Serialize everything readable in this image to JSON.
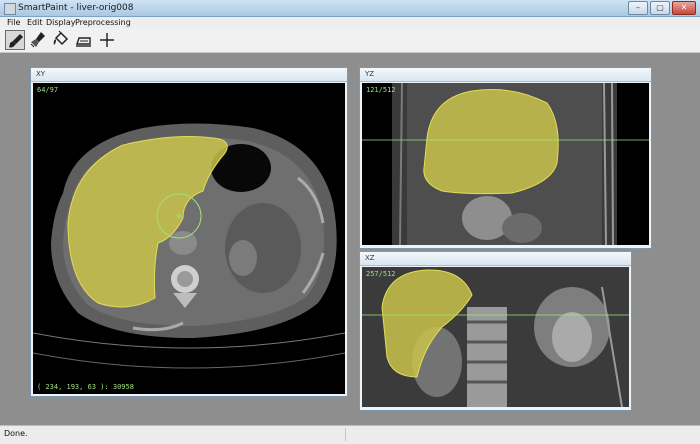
{
  "window": {
    "title": "SmartPaint - liver-orig008",
    "buttons": [
      "–",
      "▢",
      "✕"
    ]
  },
  "menu": {
    "items": [
      "File",
      "Edit",
      "Display",
      "Preprocessing"
    ]
  },
  "toolbar": {
    "tools": [
      {
        "name": "paint-brush-icon",
        "active": true
      },
      {
        "name": "sweep-brush-icon",
        "active": false
      },
      {
        "name": "bucket-fill-icon",
        "active": false
      },
      {
        "name": "iron-icon",
        "active": false
      },
      {
        "name": "crosshair-icon",
        "active": false
      }
    ]
  },
  "views": {
    "xy": {
      "title": "XY",
      "slice": "64/97",
      "coords": "( 234, 193, 63 ): 30958"
    },
    "yz": {
      "title": "YZ",
      "slice": "121/512"
    },
    "xz": {
      "title": "XZ",
      "slice": "257/512"
    }
  },
  "status": {
    "text": "Done."
  },
  "colors": {
    "overlay": "#c9c34a",
    "crosshair": "#9fe37d",
    "panel_border": "#7c99b3"
  }
}
